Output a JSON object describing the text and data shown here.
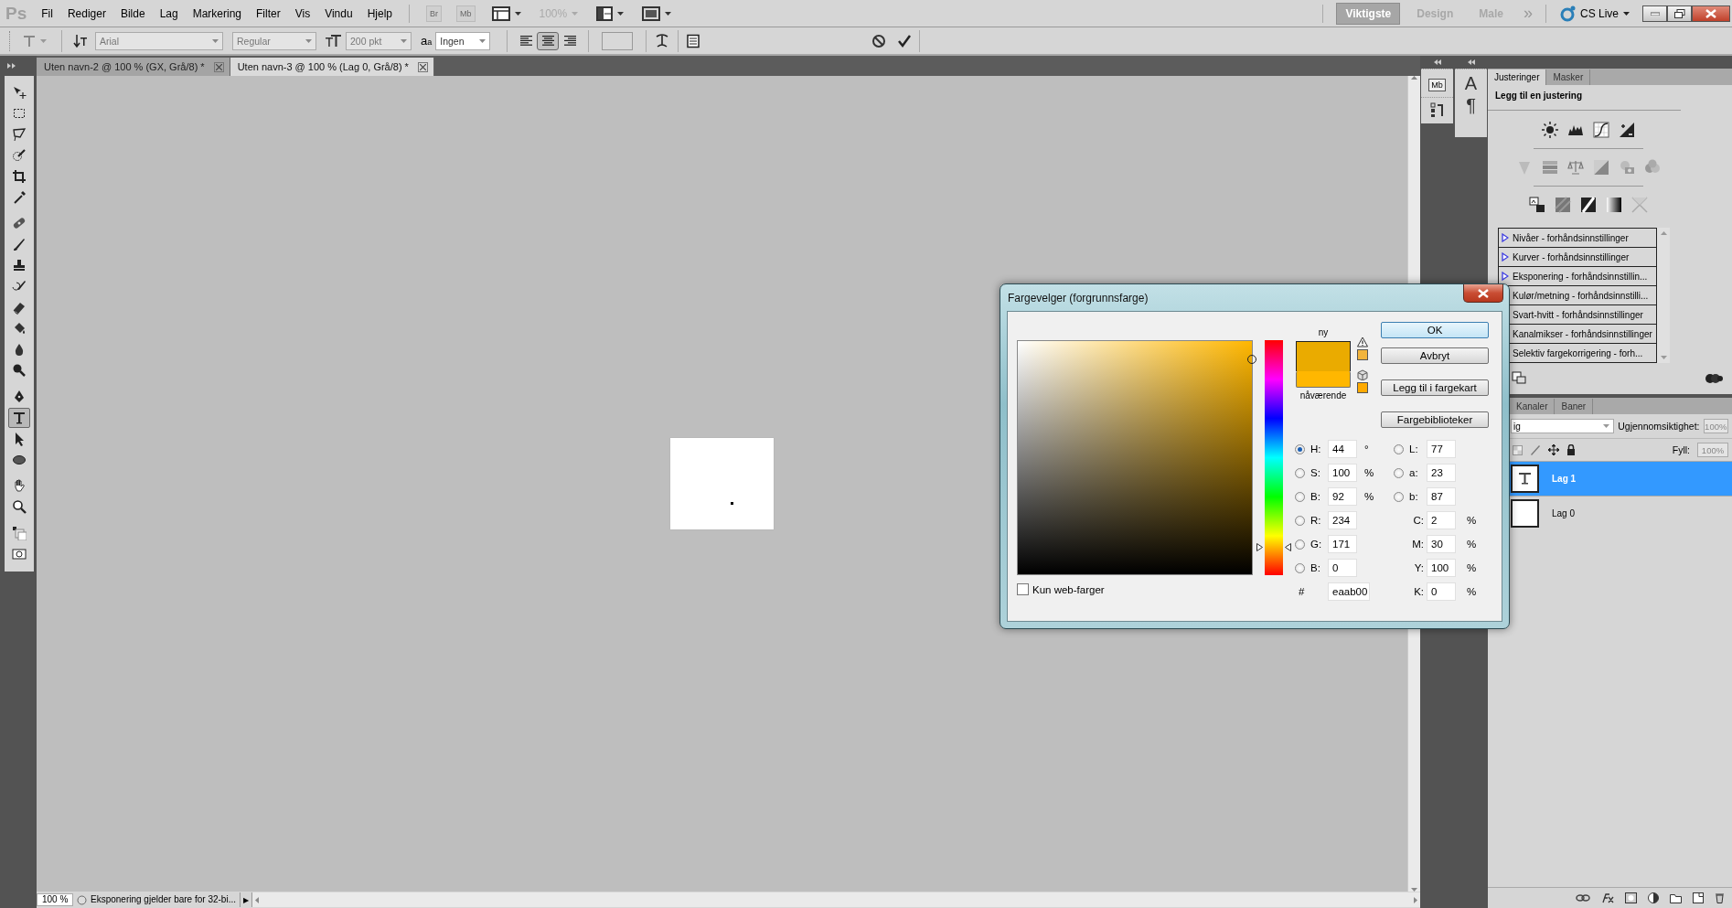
{
  "app_bar": {
    "logo": "Ps",
    "menus": [
      "Fil",
      "Rediger",
      "Bilde",
      "Lag",
      "Markering",
      "Filter",
      "Vis",
      "Vindu",
      "Hjelp"
    ],
    "bridge_button": "Br",
    "mini_bridge_button": "Mb",
    "zoom": "100%",
    "workspaces": [
      {
        "label": "Viktigste",
        "selected": true
      },
      {
        "label": "Design",
        "selected": false
      },
      {
        "label": "Male",
        "selected": false
      }
    ],
    "more": "»",
    "cs_live": "CS Live"
  },
  "options_bar": {
    "font_family": "Arial",
    "font_style": "Regular",
    "font_size": "200 pkt",
    "anti_alias_icon": "a",
    "anti_alias_icon_small": "a",
    "anti_alias": "Ingen",
    "alignments": [
      {
        "kind": "left",
        "selected": false
      },
      {
        "kind": "center",
        "selected": true
      },
      {
        "kind": "right",
        "selected": false
      }
    ]
  },
  "tools": [
    {
      "kind": "move",
      "selected": false
    },
    {
      "kind": "marquee",
      "selected": false
    },
    {
      "kind": "lasso",
      "selected": false
    },
    {
      "kind": "quickselect",
      "selected": false
    },
    {
      "kind": "crop",
      "selected": false
    },
    {
      "kind": "eyedropper",
      "selected": false
    },
    {
      "kind": "healing",
      "selected": false
    },
    {
      "kind": "brush",
      "selected": false
    },
    {
      "kind": "stamp",
      "selected": false
    },
    {
      "kind": "historybrush",
      "selected": false
    },
    {
      "kind": "eraser",
      "selected": false
    },
    {
      "kind": "bucket",
      "selected": false
    },
    {
      "kind": "blur",
      "selected": false
    },
    {
      "kind": "dodge",
      "selected": false
    },
    {
      "kind": "pen",
      "selected": false
    },
    {
      "kind": "type",
      "selected": true
    },
    {
      "kind": "pathselect",
      "selected": false
    },
    {
      "kind": "ellipse",
      "selected": false
    },
    {
      "kind": "hand",
      "selected": false
    },
    {
      "kind": "zoom",
      "selected": false
    },
    {
      "kind": "colors",
      "selected": false
    },
    {
      "kind": "quickmask",
      "selected": false
    }
  ],
  "document_tabs": [
    {
      "title": "Uten navn-2 @ 100 % (GX, Grå/8) *",
      "selected": false
    },
    {
      "title": "Uten navn-3 @ 100 % (Lag 0, Grå/8) *",
      "selected": true
    }
  ],
  "status_bar": {
    "zoom": "100 %",
    "info": "Eksponering gjelder bare for 32-bi...",
    "arrow": "▶"
  },
  "panel_strip": {
    "mini_bridge": "Mb",
    "character": "A",
    "paragraph": "¶"
  },
  "adjustments_panel": {
    "tabs": [
      {
        "label": "Justeringer",
        "selected": true
      },
      {
        "label": "Masker",
        "selected": false
      }
    ],
    "heading": "Legg til en justering",
    "presets": [
      {
        "label": "Nivåer - forhåndsinnstillinger",
        "expanded": false
      },
      {
        "label": "Kurver - forhåndsinnstillinger",
        "expanded": false
      },
      {
        "label": "Eksponering - forhåndsinnstillin...",
        "expanded": false
      },
      {
        "label": "Kulør/metning - forhåndsinnstilli..."
      },
      {
        "label": "Svart-hvitt - forhåndsinnstillinger"
      },
      {
        "label": "Kanalmikser - forhåndsinnstillinger"
      },
      {
        "label": "Selektiv fargekorrigering - forh..."
      }
    ]
  },
  "layers_panel": {
    "tabs": [
      "Kanaler",
      "Baner"
    ],
    "blend_mode": "ig",
    "opacity_label": "Ugjennomsiktighet:",
    "opacity": "100%",
    "fill_label": "Fyll:",
    "fill": "100%",
    "layers": [
      {
        "name": "Lag 1",
        "kind": "text",
        "selected": true
      },
      {
        "name": "Lag 0",
        "kind": "pixel",
        "selected": false
      }
    ]
  },
  "color_picker": {
    "title": "Fargevelger (forgrunnsfarge)",
    "hue_slider": {
      "level": 0.12
    },
    "swatches": [
      {
        "label": "ny",
        "color": "#eaab00"
      },
      {
        "label": "nåværende",
        "color": "#ffb700"
      }
    ],
    "warnings": [
      {
        "kind": "gamut",
        "color": "#f2b43c"
      },
      {
        "kind": "web",
        "color": "#ffaa00"
      }
    ],
    "buttons": [
      {
        "label": "OK",
        "default": true
      },
      {
        "label": "Avbryt",
        "default": false
      },
      {
        "label": "Legg til i fargekart",
        "default": false
      },
      {
        "label": "Fargebiblioteker",
        "default": false
      }
    ],
    "fields_left": [
      {
        "label": "H:",
        "value": "44",
        "unit": "°",
        "kind": "radio",
        "selected": true
      },
      {
        "label": "S:",
        "value": "100",
        "unit": "%",
        "kind": "radio",
        "selected": false
      },
      {
        "label": "B:",
        "value": "92",
        "unit": "%",
        "kind": "radio",
        "selected": false
      },
      {
        "label": "R:",
        "value": "234",
        "kind": "radio",
        "selected": false
      },
      {
        "label": "G:",
        "value": "171",
        "kind": "radio",
        "selected": false
      },
      {
        "label": "B:",
        "value": "0",
        "kind": "radio",
        "selected": false
      }
    ],
    "hex": {
      "label": "#",
      "value": "eaab00"
    },
    "fields_right": [
      {
        "label": "L:",
        "value": "77",
        "kind": "radio",
        "selected": false
      },
      {
        "label": "a:",
        "value": "23",
        "kind": "radio",
        "selected": false
      },
      {
        "label": "b:",
        "value": "87",
        "kind": "radio",
        "selected": false
      },
      {
        "label": "C:",
        "value": "2",
        "unit": "%",
        "kind": "plain"
      },
      {
        "label": "M:",
        "value": "30",
        "unit": "%",
        "kind": "plain"
      },
      {
        "label": "Y:",
        "value": "100",
        "unit": "%",
        "kind": "plain"
      },
      {
        "label": "K:",
        "value": "0",
        "unit": "%",
        "kind": "plain"
      }
    ],
    "web_only": {
      "label": "Kun web-farger",
      "checked": false
    }
  }
}
